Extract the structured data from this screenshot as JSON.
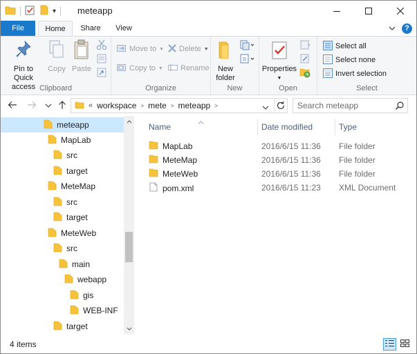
{
  "window": {
    "title": "meteapp",
    "qat_dropdown_symbol": "▾"
  },
  "ribbon_tabs": [
    {
      "label": "File"
    },
    {
      "label": "Home"
    },
    {
      "label": "Share"
    },
    {
      "label": "View"
    }
  ],
  "help_label": "?",
  "ribbon": {
    "clipboard": {
      "label": "Clipboard",
      "pin_label_1": "Pin to Quick",
      "pin_label_2": "access",
      "copy_label": "Copy",
      "paste_label": "Paste"
    },
    "organize": {
      "label": "Organize",
      "move_to": "Move to",
      "copy_to": "Copy to",
      "delete": "Delete",
      "rename": "Rename"
    },
    "new": {
      "label": "New",
      "new_folder_1": "New",
      "new_folder_2": "folder"
    },
    "open": {
      "label": "Open",
      "properties": "Properties"
    },
    "select": {
      "label": "Select",
      "select_all": "Select all",
      "select_none": "Select none",
      "invert_selection": "Invert selection"
    }
  },
  "address": {
    "overflow": "«",
    "crumbs": [
      "workspace",
      "mete",
      "meteapp"
    ]
  },
  "search": {
    "placeholder": "Search meteapp"
  },
  "nav_tree": [
    {
      "label": "meteapp",
      "selected": true
    },
    {
      "label": "MapLab"
    },
    {
      "label": "src"
    },
    {
      "label": "target"
    },
    {
      "label": "MeteMap"
    },
    {
      "label": "src"
    },
    {
      "label": "target"
    },
    {
      "label": "MeteWeb"
    },
    {
      "label": "src"
    },
    {
      "label": "main"
    },
    {
      "label": "webapp"
    },
    {
      "label": "gis"
    },
    {
      "label": "WEB-INF"
    },
    {
      "label": "target"
    }
  ],
  "columns": {
    "name": "Name",
    "date": "Date modified",
    "type": "Type"
  },
  "files": [
    {
      "name": "MapLab",
      "date": "2016/6/15 11:36",
      "type": "File folder",
      "icon": "folder-icon"
    },
    {
      "name": "MeteMap",
      "date": "2016/6/15 11:36",
      "type": "File folder",
      "icon": "folder-icon"
    },
    {
      "name": "MeteWeb",
      "date": "2016/6/15 11:36",
      "type": "File folder",
      "icon": "folder-icon"
    },
    {
      "name": "pom.xml",
      "date": "2016/6/15 11:23",
      "type": "XML Document",
      "icon": "document-icon"
    }
  ],
  "status": {
    "item_count": "4 items"
  },
  "colors": {
    "accent": "#1979ca",
    "selection": "#cce8ff",
    "folder": "#f8c33c"
  }
}
